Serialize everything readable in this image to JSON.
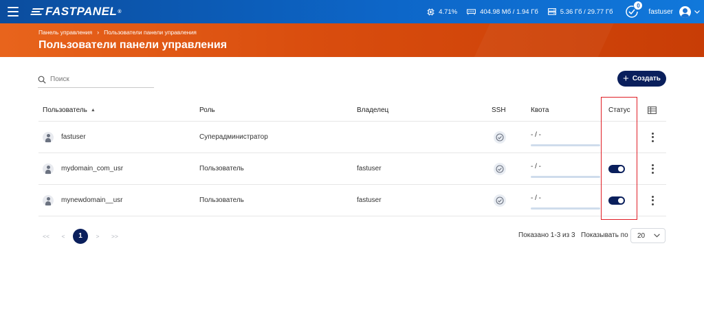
{
  "topbar": {
    "brand": "FASTPANEL",
    "brand_mark": "®",
    "cpu": "4.71%",
    "memory": "404.98 Мб / 1.94 Гб",
    "disk": "5.36 Гб / 29.77 Гб",
    "notifications_count": "0",
    "username": "fastuser"
  },
  "breadcrumb": {
    "root": "Панель управления",
    "separator": "›",
    "current": "Пользователи панели управления"
  },
  "page_title": "Пользователи панели управления",
  "search": {
    "placeholder": "Поиск"
  },
  "create_button": {
    "plus": "+",
    "label": "Создать"
  },
  "table": {
    "headers": {
      "user": "Пользователь",
      "sort_indicator": "▲",
      "role": "Роль",
      "owner": "Владелец",
      "ssh": "SSH",
      "quota": "Квота",
      "status": "Статус"
    },
    "rows": [
      {
        "user": "fastuser",
        "role": "Суперадминистратор",
        "owner": "",
        "quota": "- / -",
        "status_on": null
      },
      {
        "user": "mydomain_com_usr",
        "role": "Пользователь",
        "owner": "fastuser",
        "quota": "- / -",
        "status_on": true
      },
      {
        "user": "mynewdomain__usr",
        "role": "Пользователь",
        "owner": "fastuser",
        "quota": "- / -",
        "status_on": true
      }
    ]
  },
  "pagination": {
    "first": "<<",
    "prev": "<",
    "current_page": "1",
    "next": ">",
    "last": ">>",
    "summary": "Показано 1-3 из 3",
    "per_page_label": "Показывать по",
    "per_page_value": "20"
  },
  "colors": {
    "topbar": "#0d66c8",
    "hero": "#d94d0e",
    "accent_dark": "#0a1f5c",
    "highlight": "#e01c24"
  }
}
